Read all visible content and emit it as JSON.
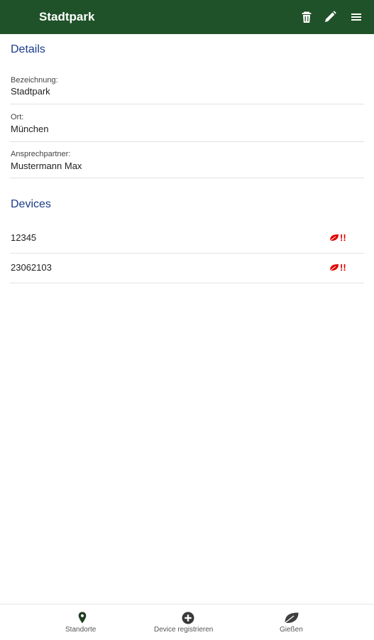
{
  "header": {
    "title": "Stadtpark",
    "actions": [
      "delete-icon",
      "edit-icon",
      "menu-icon"
    ]
  },
  "details": {
    "title": "Details",
    "fields": [
      {
        "label": "Bezeichnung:",
        "value": "Stadtpark"
      },
      {
        "label": "Ort:",
        "value": "München"
      },
      {
        "label": "Ansprechpartner:",
        "value": "Mustermann Max"
      }
    ]
  },
  "devices": {
    "title": "Devices",
    "items": [
      {
        "id": "12345",
        "status": "!!"
      },
      {
        "id": "23062103",
        "status": "!!"
      }
    ]
  },
  "bottom_nav": {
    "items": [
      {
        "label": "Standorte",
        "icon": "map-marker-icon"
      },
      {
        "label": "Device registrieren",
        "icon": "plus-circle-icon"
      },
      {
        "label": "Gießen",
        "icon": "leaf-icon"
      }
    ]
  },
  "colors": {
    "appbar": "#1f5228",
    "section_title": "#1a3a8a",
    "alert": "#e00000"
  }
}
